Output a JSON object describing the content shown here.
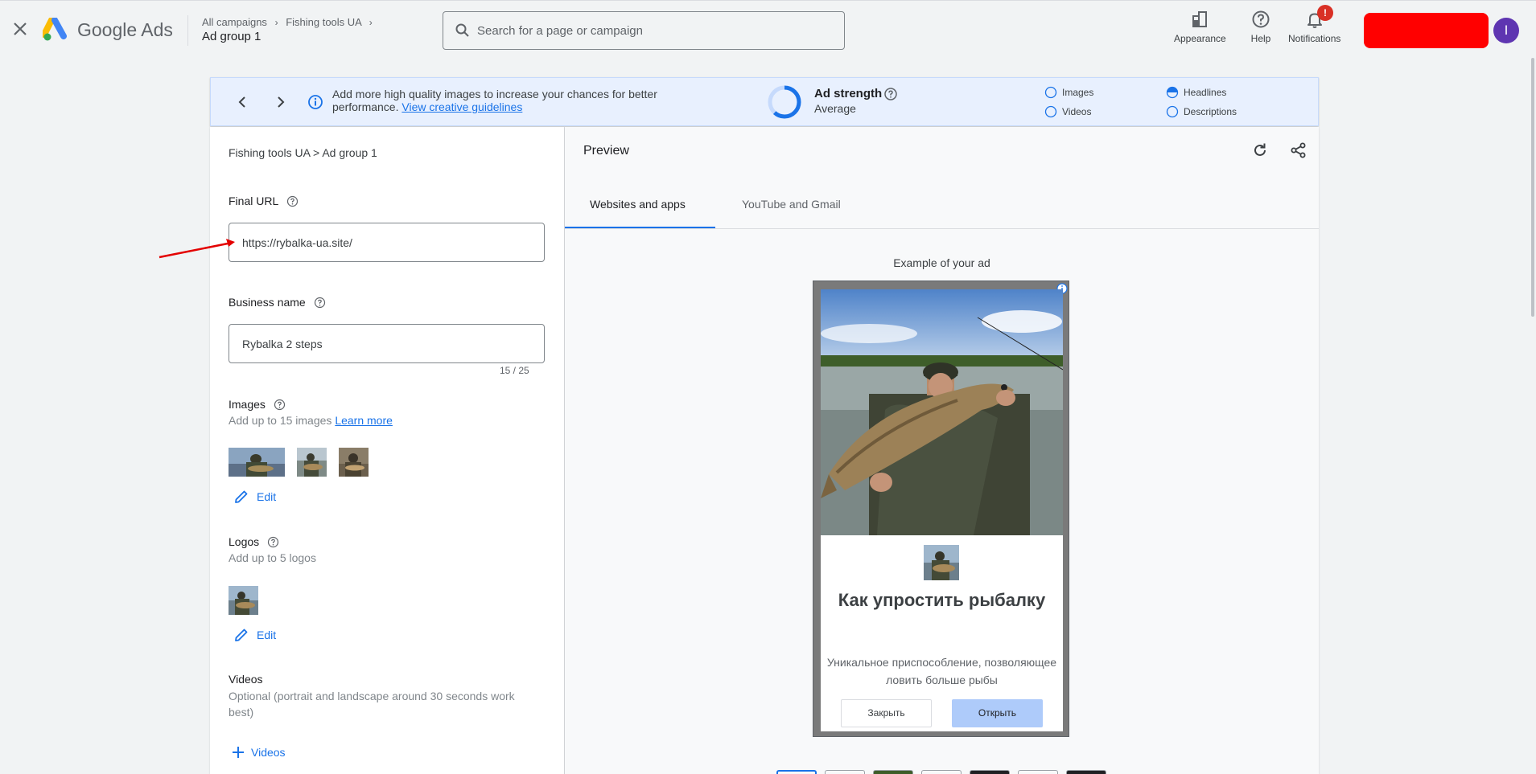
{
  "topbar": {
    "brand": "Google Ads",
    "breadcrumbs": [
      "All campaigns",
      "Fishing tools UA"
    ],
    "current": "Ad group 1",
    "search_placeholder": "Search for a page or campaign",
    "tools": [
      {
        "label": "Appearance",
        "icon": "appearance-icon"
      },
      {
        "label": "Help",
        "icon": "help-icon"
      },
      {
        "label": "Notifications",
        "icon": "bell-icon"
      }
    ],
    "notification_badge": "!",
    "avatar_letter": "I"
  },
  "banner": {
    "text": "Add more high quality images to increase your chances for better performance.",
    "link": "View creative guidelines",
    "strength_title": "Ad strength",
    "strength_value": "Average",
    "checklist": [
      {
        "label": "Images",
        "state": "empty"
      },
      {
        "label": "Headlines",
        "state": "half"
      },
      {
        "label": "Videos",
        "state": "empty"
      },
      {
        "label": "Descriptions",
        "state": "empty"
      }
    ]
  },
  "form": {
    "path": "Fishing tools UA > Ad group 1",
    "final_url_label": "Final URL",
    "final_url_value": "https://rybalka-ua.site/",
    "business_name_label": "Business name",
    "business_name_value": "Rybalka 2 steps",
    "business_name_counter": "15 / 25",
    "images_label": "Images",
    "images_hint": "Add up to 15 images",
    "images_link": "Learn more",
    "images_edit": "Edit",
    "logos_label": "Logos",
    "logos_hint": "Add up to 5 logos",
    "logos_edit": "Edit",
    "videos_label": "Videos",
    "videos_hint": "Optional (portrait and landscape around 30 seconds work best)",
    "videos_add": "Videos"
  },
  "preview": {
    "title": "Preview",
    "tabs": [
      "Websites and apps",
      "YouTube and Gmail"
    ],
    "active_tab": "Websites and apps",
    "example_label": "Example of your ad",
    "ad": {
      "headline": "Как упростить рыбалку",
      "description": "Уникальное приспособление, позволяющее ловить больше рыбы",
      "close_button": "Закрыть",
      "open_button": "Открыть"
    }
  },
  "colors": {
    "accent": "#1a73e8",
    "banner_bg": "#e8f0fe",
    "avatar": "#5e35b1",
    "badge": "#d93025",
    "redaction": "#ff0000"
  }
}
